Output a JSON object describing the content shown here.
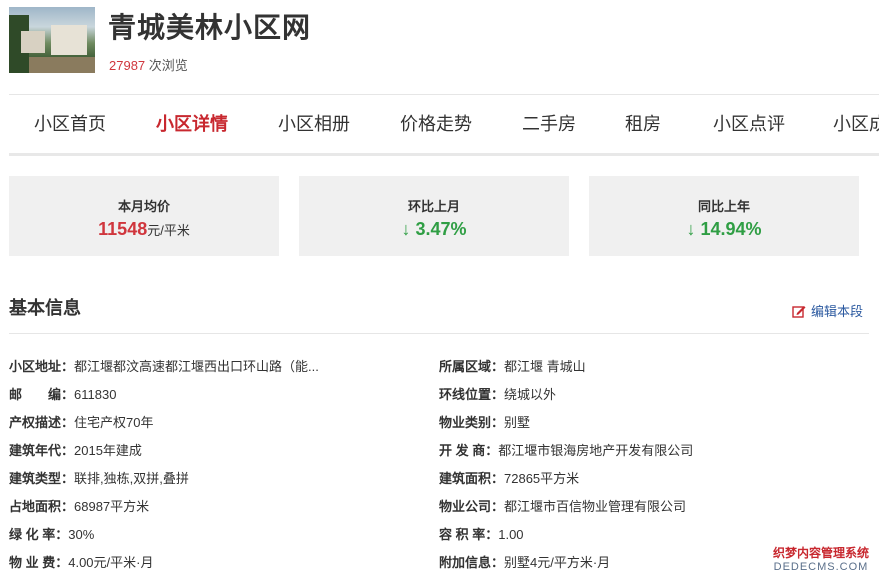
{
  "header": {
    "title": "青城美林小区网",
    "views_count": "27987",
    "views_suffix": " 次浏览"
  },
  "nav": {
    "tabs": [
      "小区首页",
      "小区详情",
      "小区相册",
      "价格走势",
      "二手房",
      "租房",
      "小区点评",
      "小区成"
    ],
    "active_index": 1
  },
  "stats": [
    {
      "label": "本月均价",
      "value": "11548",
      "unit": "元/平米"
    },
    {
      "label": "环比上月",
      "value": "↓ 3.47%"
    },
    {
      "label": "同比上年",
      "value": "↓ 14.94%"
    }
  ],
  "basic_info": {
    "title": "基本信息",
    "edit_label": "编辑本段",
    "left": [
      {
        "key": "小区地址：",
        "value": "都江堰都汶高速都江堰西出口环山路（能..."
      },
      {
        "key": "邮　　编：",
        "value": "611830"
      },
      {
        "key": "产权描述：",
        "value": "住宅产权70年"
      },
      {
        "key": "建筑年代：",
        "value": "2015年建成"
      },
      {
        "key": "建筑类型：",
        "value": "联排,独栋,双拼,叠拼"
      },
      {
        "key": "占地面积：",
        "value": "68987平方米"
      },
      {
        "key": "绿 化 率：",
        "value": "30%"
      },
      {
        "key": "物 业 费：",
        "value": "4.00元/平米·月"
      }
    ],
    "right": [
      {
        "key": "所属区域：",
        "value": "都江堰 青城山"
      },
      {
        "key": "环线位置：",
        "value": "绕城以外"
      },
      {
        "key": "物业类别：",
        "value": "别墅"
      },
      {
        "key": "开 发 商：",
        "value": "都江堰市银海房地产开发有限公司"
      },
      {
        "key": "建筑面积：",
        "value": "72865平方米"
      },
      {
        "key": "物业公司：",
        "value": "都江堰市百信物业管理有限公司"
      },
      {
        "key": "容 积 率：",
        "value": "1.00"
      },
      {
        "key": "附加信息：",
        "value": "别墅4元/平方米·月"
      }
    ]
  },
  "watermark": {
    "line1": "织梦内容管理系统",
    "line2": "DEDECMS.COM"
  },
  "colors": {
    "accent": "#c8282f",
    "up_down_green": "#2f9e44",
    "link": "#2c5aa0"
  }
}
